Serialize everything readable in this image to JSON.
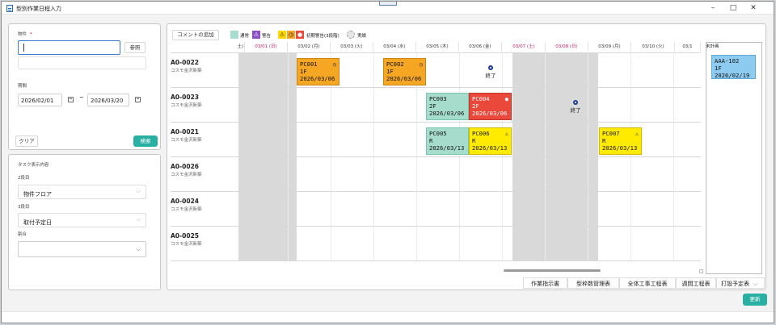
{
  "window": {
    "title": "型別作業日程入力",
    "minimize": "–",
    "maximize": "□",
    "close": "✕"
  },
  "search": {
    "property_label": "物件",
    "required_mark": "*",
    "property_value": "",
    "browse_button": "参照",
    "period_label": "期間",
    "date_from": "2026/02/01",
    "range_sep": "~",
    "date_to": "2026/03/20",
    "clear_button": "クリア",
    "search_button": "検索"
  },
  "task_display": {
    "title": "タスク表示内容",
    "row2_label": "2段目",
    "row2_value": "物件フロア",
    "row3_label": "3段目",
    "row3_value": "取付予定日",
    "merge_label": "割合",
    "merge_value": ""
  },
  "toolbar": {
    "add_comment": "コメントの追加"
  },
  "legend": [
    {
      "label": "通常",
      "color": "#a6dccb",
      "icon": ""
    },
    {
      "label": "警告",
      "color": "#8b4fc5",
      "icon": "warning-triangle-icon"
    },
    {
      "label": "初期警告(3段階)",
      "color": "#ffd700",
      "icon": "warning-triangle-icon"
    },
    {
      "label": "実績",
      "color": "#e6e6e6",
      "icon": "dashed-circle-icon"
    }
  ],
  "dates": [
    "土)",
    "03/01 (日)",
    "03/02 (月)",
    "03/03 (火)",
    "03/04 (水)",
    "03/05 (木)",
    "03/06 (金)",
    "03/07 (土)",
    "03/08 (日)",
    "03/09 (月)",
    "03/10 (火)",
    "03/1"
  ],
  "rows": [
    {
      "id": "A0-0022",
      "sub": "コスモ金沢新築"
    },
    {
      "id": "A0-0023",
      "sub": "コスモ金沢新築"
    },
    {
      "id": "A0-0021",
      "sub": "コスモ金沢新築"
    },
    {
      "id": "A0-0026",
      "sub": "コスモ金沢新築"
    },
    {
      "id": "A0-0024",
      "sub": "コスモ金沢新築"
    },
    {
      "id": "A0-0025",
      "sub": "コスモ金沢新築"
    }
  ],
  "cards": [
    {
      "name": "PC001",
      "floor": "1F",
      "date": "2026/03/06",
      "color": "#f5a623",
      "icon": "clock-icon"
    },
    {
      "name": "PC002",
      "floor": "1F",
      "date": "2026/03/06",
      "color": "#f5a623",
      "icon": "clock-icon"
    },
    {
      "name": "PC003",
      "floor": "2F",
      "date": "2026/03/06",
      "color": "#a6dccb",
      "icon": ""
    },
    {
      "name": "PC004",
      "floor": "2F",
      "date": "2026/03/06",
      "color": "#e9483b",
      "icon": "circle-icon"
    },
    {
      "name": "PC005",
      "floor": "R",
      "date": "2026/03/13",
      "color": "#a6dccb",
      "icon": ""
    },
    {
      "name": "PC006",
      "floor": "R",
      "date": "2026/03/13",
      "color": "#ffeb00",
      "icon": "warning-triangle-icon"
    },
    {
      "name": "PC007",
      "floor": "R",
      "date": "2026/03/13",
      "color": "#ffeb00",
      "icon": "warning-triangle-icon"
    }
  ],
  "finished_label": "終了",
  "unplanned": {
    "title": "未計画",
    "card": {
      "name": "AAA-102",
      "floor": "1F",
      "date": "2026/02/19",
      "color": "#8ecbf0"
    }
  },
  "nav_buttons": [
    "作業指示書",
    "型枠数管理表",
    "全体工事工程表",
    "週間工程表",
    "打設予定表"
  ],
  "update_button": "更新"
}
